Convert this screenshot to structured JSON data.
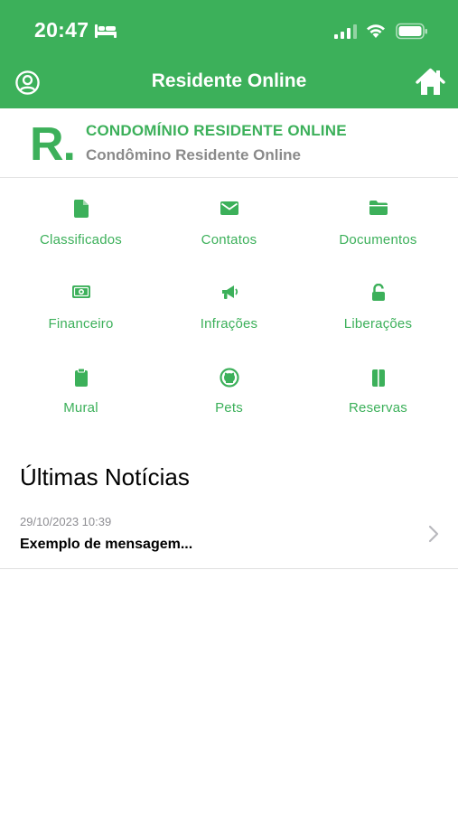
{
  "status_bar": {
    "time": "20:47"
  },
  "nav": {
    "title": "Residente Online"
  },
  "condo": {
    "logo": "R.",
    "name": "CONDOMÍNIO RESIDENTE ONLINE",
    "subtitle": "Condômino Residente Online"
  },
  "menu": [
    {
      "label": "Classificados",
      "icon": "document-icon"
    },
    {
      "label": "Contatos",
      "icon": "envelope-icon"
    },
    {
      "label": "Documentos",
      "icon": "folder-icon"
    },
    {
      "label": "Financeiro",
      "icon": "money-icon"
    },
    {
      "label": "Infrações",
      "icon": "megaphone-icon"
    },
    {
      "label": "Liberações",
      "icon": "unlock-icon"
    },
    {
      "label": "Mural",
      "icon": "clipboard-icon"
    },
    {
      "label": "Pets",
      "icon": "github-icon"
    },
    {
      "label": "Reservas",
      "icon": "book-icon"
    }
  ],
  "news": {
    "title": "Últimas Notícias",
    "items": [
      {
        "date": "29/10/2023 10:39",
        "text": "Exemplo de mensagem..."
      }
    ]
  },
  "colors": {
    "accent": "#3cb05a",
    "muted": "#8a8a8a"
  }
}
